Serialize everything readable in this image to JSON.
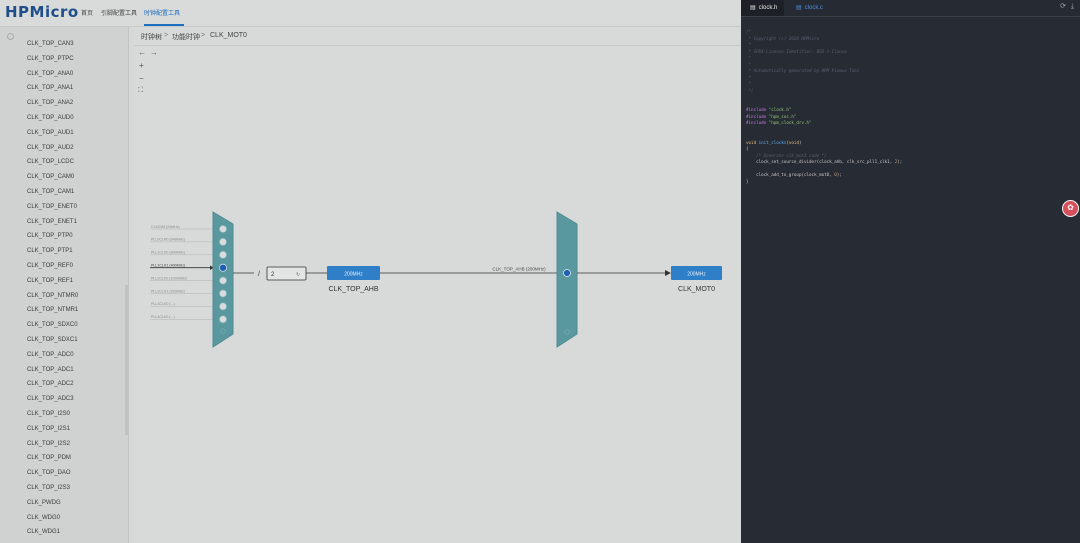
{
  "logo": "HPMicro",
  "nav": [
    "首页",
    "引脚配置工具",
    "时钟配置工具"
  ],
  "breadcrumb": [
    "时钟树",
    "功能时钟",
    "CLK_MOT0"
  ],
  "breadcrumb_sep": ">",
  "tools": {
    "back": "←",
    "forward": "→",
    "zoom_in": "+",
    "zoom_out": "−",
    "fit": "⛶"
  },
  "sidebar": [
    "CLK_TOP_CAN3",
    "CLK_TOP_PTPC",
    "CLK_TOP_ANA0",
    "CLK_TOP_ANA1",
    "CLK_TOP_ANA2",
    "CLK_TOP_AUD0",
    "CLK_TOP_AUD1",
    "CLK_TOP_AUD2",
    "CLK_TOP_LCDC",
    "CLK_TOP_CAM0",
    "CLK_TOP_CAM1",
    "CLK_TOP_ENET0",
    "CLK_TOP_ENET1",
    "CLK_TOP_PTP0",
    "CLK_TOP_PTP1",
    "CLK_TOP_REF0",
    "CLK_TOP_REF1",
    "CLK_TOP_NTMR0",
    "CLK_TOP_NTMR1",
    "CLK_TOP_SDXC0",
    "CLK_TOP_SDXC1",
    "CLK_TOP_ADC0",
    "CLK_TOP_ADC1",
    "CLK_TOP_ADC2",
    "CLK_TOP_ADC3",
    "CLK_TOP_I2S0",
    "CLK_TOP_I2S1",
    "CLK_TOP_I2S2",
    "CLK_TOP_PDM",
    "CLK_TOP_DAO",
    "CLK_TOP_I2S3",
    "CLK_PWDG",
    "CLK_WDG0",
    "CLK_WDG1"
  ],
  "diagram": {
    "sources": [
      "CLK24M (24MHz)",
      "PLL0CLK0 (648MHz)",
      "PLL1CLK0 (800MHz)",
      "PLL1CLK1 (400MHz)",
      "PLL2CLK0 (1000MHz)",
      "PLL2CLK1 (333MHz)",
      "PLL3CLK0 (...)",
      "PLL4CLK0 (...)"
    ],
    "selected_source": 3,
    "divider_label": "/",
    "divider_value": "2",
    "ahb_freq": "200MHz",
    "ahb_label": "CLK_TOP_AHB",
    "mux2_input": "CLK_TOP_AHB (200MHz)",
    "out_freq": "200MHz",
    "out_label": "CLK_MOT0"
  },
  "editor": {
    "tabs": [
      "clock.h",
      "clock.c"
    ],
    "actions": {
      "refresh": "⟳",
      "download": "⤓"
    }
  },
  "colors": {
    "accent": "#1e6fc0",
    "node": "#2e7fc7",
    "mux": "#5a98a0",
    "editor_bg": "#272b34"
  }
}
